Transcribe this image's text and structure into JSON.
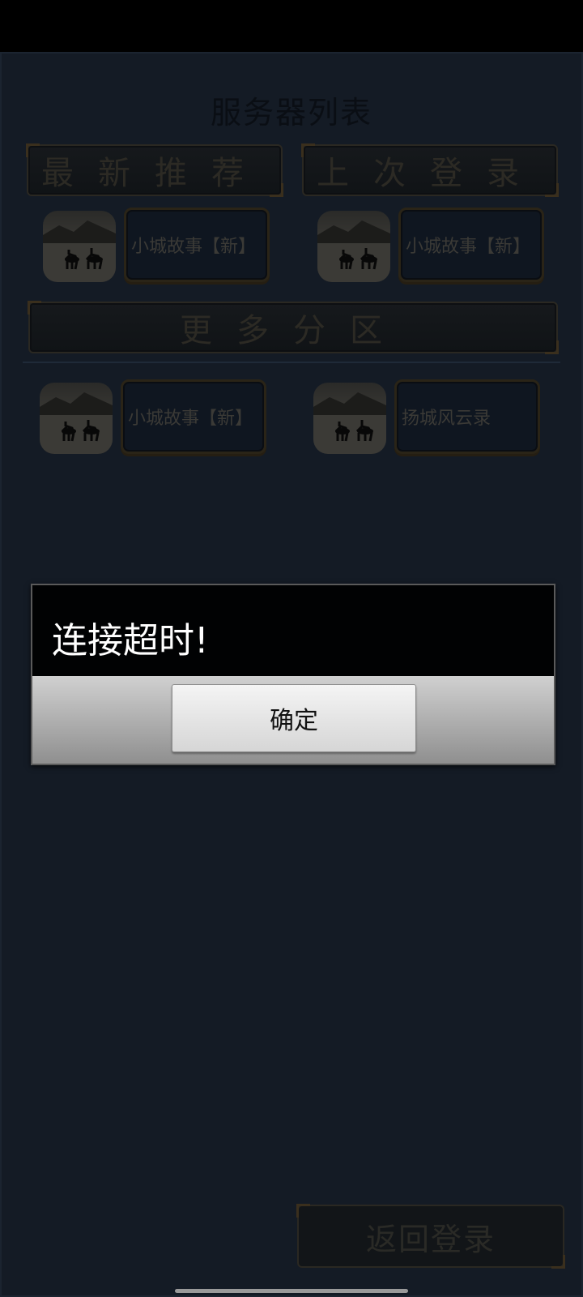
{
  "page": {
    "title": "服务器列表"
  },
  "sections": {
    "latest_label": "最新推荐",
    "last_login_label": "上次登录",
    "more_label": "更多分区"
  },
  "servers": {
    "latest": [
      {
        "name": "小城故事【新】"
      }
    ],
    "last_login": [
      {
        "name": "小城故事【新】"
      }
    ],
    "more": [
      {
        "name": "小城故事【新】"
      },
      {
        "name": "扬城风云录"
      }
    ]
  },
  "back_button": {
    "label": "返回登录"
  },
  "dialog": {
    "message": "连接超时!",
    "ok_label": "确定"
  },
  "colors": {
    "background": "#141b25",
    "dialog_message_bg": "#010203",
    "dialog_footer_gradient_top": "#d0d0d0",
    "dialog_footer_gradient_bottom": "#8f8f8f"
  },
  "icons": {
    "server_thumbnail": "horse-riders-landscape-icon",
    "loading": "loading-spinner-icon"
  }
}
